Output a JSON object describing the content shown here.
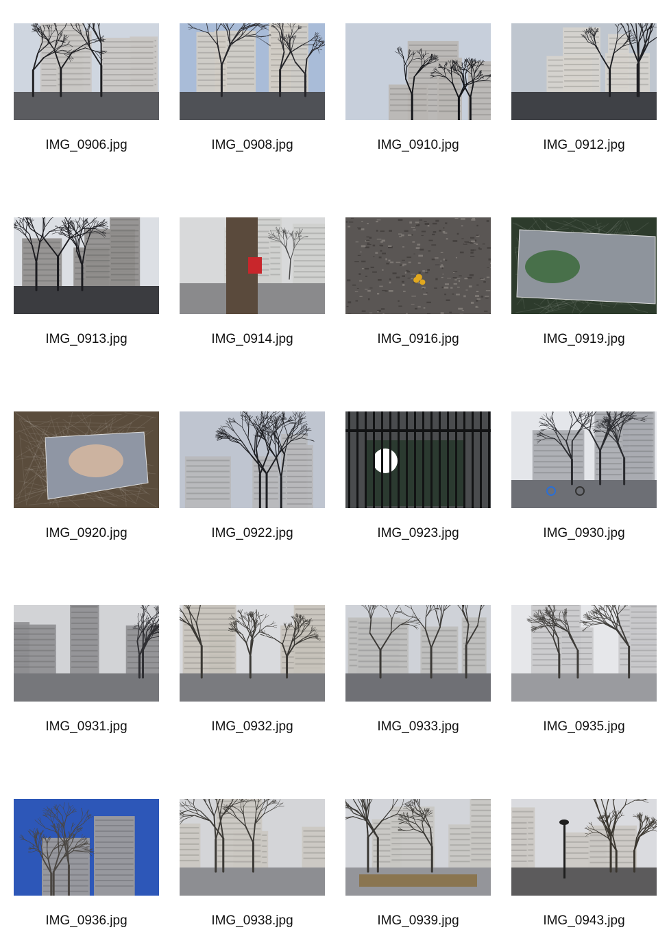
{
  "gallery": {
    "items": [
      {
        "filename": "IMG_0906.jpg",
        "scene": "plaza-buildings-trees",
        "palette": {
          "sky": "#cfd6e0",
          "building": "#c9c7c3",
          "ground": "#5b5c60",
          "tree": "#1f1f22"
        }
      },
      {
        "filename": "IMG_0908.jpg",
        "scene": "plaza-buildings-trees",
        "palette": {
          "sky": "#a9bcd8",
          "building": "#d1cdc5",
          "ground": "#4f5156",
          "tree": "#26262a"
        }
      },
      {
        "filename": "IMG_0910.jpg",
        "scene": "tree-canopy-building",
        "palette": {
          "sky": "#c7cfdb",
          "building": "#b9b6b2",
          "ground": "#6b6b70",
          "tree": "#15161a"
        }
      },
      {
        "filename": "IMG_0912.jpg",
        "scene": "plaza-buildings-trees",
        "palette": {
          "sky": "#bfc6cf",
          "building": "#d6d3cd",
          "ground": "#3f4146",
          "tree": "#1e1f23"
        }
      },
      {
        "filename": "IMG_0913.jpg",
        "scene": "plaza-buildings-trees",
        "palette": {
          "sky": "#dcdfe4",
          "building": "#8f8d8b",
          "ground": "#3b3c40",
          "tree": "#1c1c20"
        }
      },
      {
        "filename": "IMG_0914.jpg",
        "scene": "tree-trunk-red-box",
        "palette": {
          "sky": "#d8d9da",
          "building": "#cfcfcd",
          "ground": "#8a8a8c",
          "tree": "#5a4a3c"
        }
      },
      {
        "filename": "IMG_0916.jpg",
        "scene": "mulch-yellow-flowers",
        "palette": {
          "sky": "#6e6b69",
          "building": "#6e6b69",
          "ground": "#5a5654",
          "tree": "#e1a81f"
        }
      },
      {
        "filename": "IMG_0919.jpg",
        "scene": "sign-collect-pond-green",
        "palette": {
          "sky": "#4a4845",
          "building": "#8e949c",
          "ground": "#2d3b2c",
          "tree": "#3c6a3c"
        }
      },
      {
        "filename": "IMG_0920.jpg",
        "scene": "sign-collect-pond-map",
        "palette": {
          "sky": "#5d5246",
          "building": "#8f96a4",
          "ground": "#5a4c3c",
          "tree": "#d7b9a0"
        }
      },
      {
        "filename": "IMG_0922.jpg",
        "scene": "building-through-branches",
        "palette": {
          "sky": "#bfc5d0",
          "building": "#b8b8ba",
          "ground": "#8a8a8e",
          "tree": "#1d1e22"
        }
      },
      {
        "filename": "IMG_0923.jpg",
        "scene": "park-sign-fence",
        "palette": {
          "sky": "#4a4c4e",
          "building": "#2b3a30",
          "ground": "#3a3b3d",
          "tree": "#121314"
        }
      },
      {
        "filename": "IMG_0930.jpg",
        "scene": "street-cyclists",
        "palette": {
          "sky": "#e4e6ea",
          "building": "#a9abb0",
          "ground": "#6d6f75",
          "tree": "#2a2b2f"
        }
      },
      {
        "filename": "IMG_0931.jpg",
        "scene": "empty-plaza",
        "palette": {
          "sky": "#d2d3d6",
          "building": "#8e8e91",
          "ground": "#76777b",
          "tree": "#2f2f33"
        }
      },
      {
        "filename": "IMG_0932.jpg",
        "scene": "plaza-buildings-trees",
        "palette": {
          "sky": "#d9dadd",
          "building": "#c7c2ba",
          "ground": "#7a7b7f",
          "tree": "#3a3834"
        }
      },
      {
        "filename": "IMG_0933.jpg",
        "scene": "plaza-buildings-trees",
        "palette": {
          "sky": "#cfd2d8",
          "building": "#bdbcbb",
          "ground": "#6f7075",
          "tree": "#3b3936"
        }
      },
      {
        "filename": "IMG_0935.jpg",
        "scene": "big-tree-building",
        "palette": {
          "sky": "#e6e7ea",
          "building": "#c9c9cb",
          "ground": "#9a9b9f",
          "tree": "#3d3b38"
        }
      },
      {
        "filename": "IMG_0936.jpg",
        "scene": "tree-against-sky",
        "palette": {
          "sky": "#2d57b8",
          "building": "#a3a09b",
          "ground": "#2b2b2e",
          "tree": "#4a4642"
        }
      },
      {
        "filename": "IMG_0938.jpg",
        "scene": "plaza-buildings-trees",
        "palette": {
          "sky": "#d4d5d8",
          "building": "#cbc8c2",
          "ground": "#8d8e92",
          "tree": "#3c3a36"
        }
      },
      {
        "filename": "IMG_0939.jpg",
        "scene": "plaza-planters",
        "palette": {
          "sky": "#d2d4d9",
          "building": "#c8c6c2",
          "ground": "#94959a",
          "tree": "#3a3834"
        }
      },
      {
        "filename": "IMG_0943.jpg",
        "scene": "park-lamp-building",
        "palette": {
          "sky": "#dadbdf",
          "building": "#cbc8c3",
          "ground": "#5c5b5c",
          "tree": "#3a362f"
        }
      }
    ]
  }
}
